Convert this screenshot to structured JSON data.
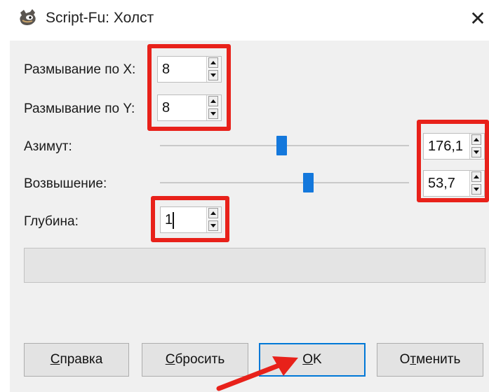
{
  "window": {
    "title": "Script-Fu: Холст",
    "close_glyph": "✕"
  },
  "fields": {
    "blur_x": {
      "label": "Размывание по X:",
      "value": "8"
    },
    "blur_y": {
      "label": "Размывание по Y:",
      "value": "8"
    },
    "azimuth": {
      "label": "Азимут:",
      "value": "176,1",
      "slider_fraction": 0.489
    },
    "elevation": {
      "label": "Возвышение:",
      "value": "53,7",
      "slider_fraction": 0.597
    },
    "depth": {
      "label": "Глубина:",
      "value": "1"
    }
  },
  "buttons": {
    "help": {
      "mnemonic": "С",
      "rest": "правка"
    },
    "reset": {
      "mnemonic": "С",
      "rest": "бросить"
    },
    "ok": {
      "mnemonic": "О",
      "rest": "K"
    },
    "cancel": {
      "prefix": "О",
      "mnemonic": "т",
      "rest": "менить"
    }
  },
  "colors": {
    "highlight_red": "#e8211a",
    "accent_blue": "#1478dc",
    "default_button_border": "#0078d7"
  },
  "icons": {
    "app": "gimp-wilber-icon",
    "close": "close-icon",
    "spin_up": "spin-up-arrow-icon",
    "spin_down": "spin-down-arrow-icon",
    "pointer": "red-pointer-arrow-icon"
  }
}
